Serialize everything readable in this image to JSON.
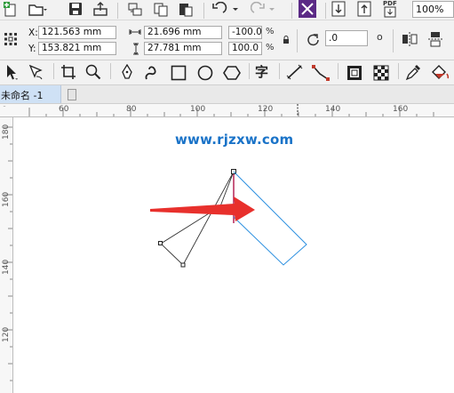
{
  "toolbar": {
    "zoom_value": "100%",
    "pdf_label": "PDF"
  },
  "property_bar": {
    "x_label": "X:",
    "x_value": "121.563 mm",
    "y_label": "Y:",
    "y_value": "153.821 mm",
    "width_value": "21.696 mm",
    "height_value": "27.781 mm",
    "scale_x_value": "-100.0",
    "scale_y_value": "100.0",
    "percent": "%",
    "rotation_value": ".0",
    "degree": "o"
  },
  "toolbox": {
    "text_tool_glyph": "字"
  },
  "document_tab": {
    "title": "未命名 -1"
  },
  "rulers": {
    "horizontal_ticks": [
      "60",
      "80",
      "100",
      "120",
      "140",
      "160"
    ],
    "vertical_ticks": [
      "180",
      "160",
      "140",
      "120"
    ]
  },
  "watermark": "www.rjzxw.com",
  "colors": {
    "selection_outline": "#333333",
    "mirrored_outline": "#2a8fe0",
    "arrow": "#e8302c",
    "active_tab": "#cfe1f5",
    "accent_purple": "#5b2a86"
  }
}
